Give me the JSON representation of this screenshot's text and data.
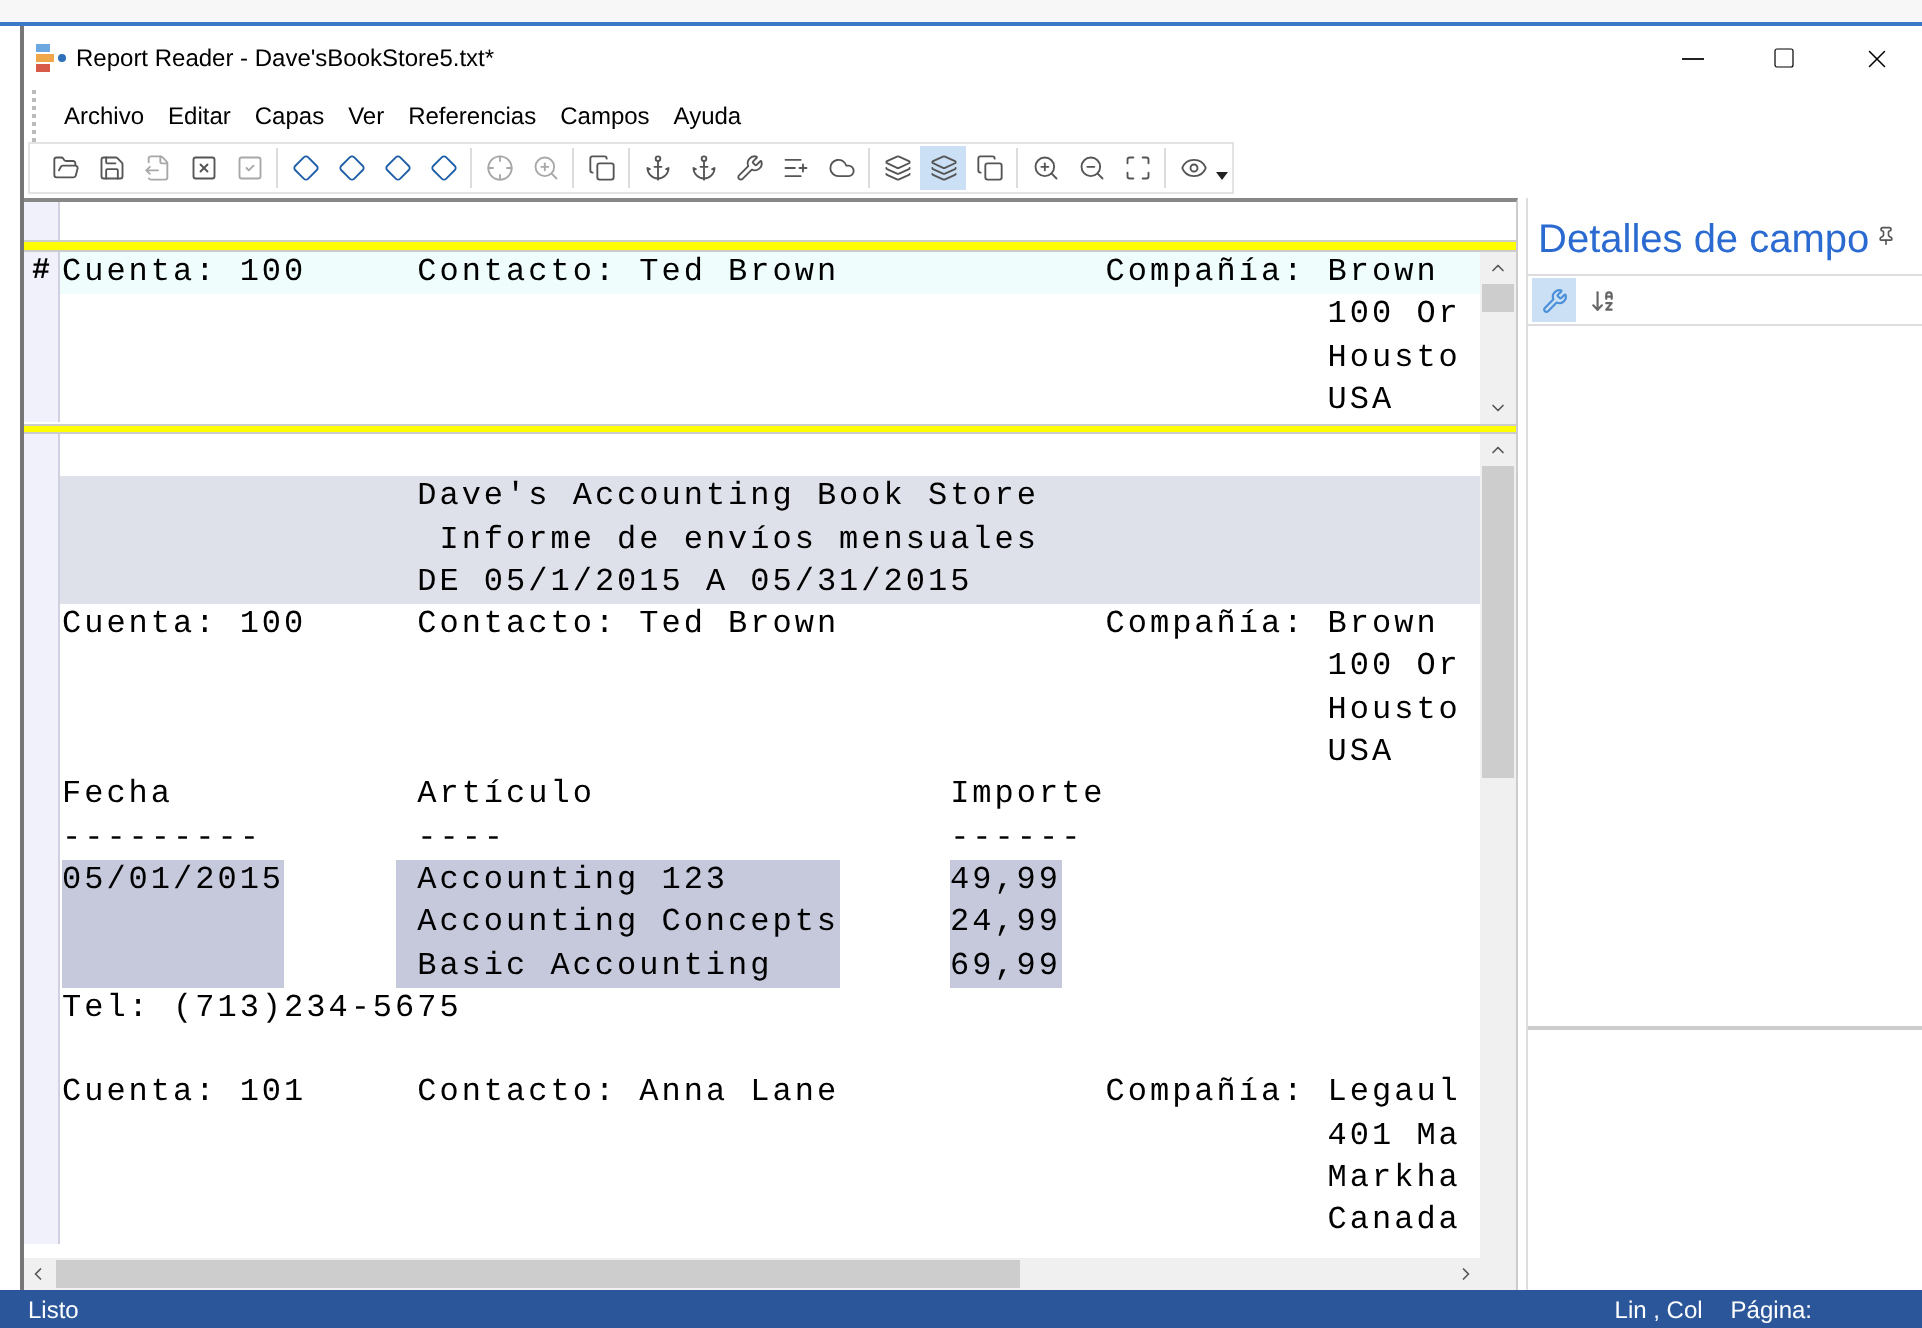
{
  "window": {
    "title": "Report Reader - Dave'sBookStore5.txt*"
  },
  "menu": [
    "Archivo",
    "Editar",
    "Capas",
    "Ver",
    "Referencias",
    "Campos",
    "Ayuda"
  ],
  "toolbar": [
    {
      "selected": false,
      "disabled": false
    },
    {
      "selected": false,
      "disabled": false
    },
    {
      "selected": false,
      "disabled": true
    },
    {
      "selected": false,
      "disabled": false
    },
    {
      "selected": false,
      "disabled": true
    },
    {
      "selected": false,
      "disabled": false
    },
    {
      "selected": false,
      "disabled": false
    },
    {
      "selected": false,
      "disabled": false
    },
    {
      "selected": false,
      "disabled": false
    },
    {
      "selected": false,
      "disabled": true
    },
    {
      "selected": false,
      "disabled": true
    },
    {
      "selected": false,
      "disabled": false
    },
    {
      "selected": false,
      "disabled": false
    },
    {
      "selected": false,
      "disabled": false
    },
    {
      "selected": false,
      "disabled": false
    },
    {
      "selected": false,
      "disabled": false
    },
    {
      "selected": false,
      "disabled": false
    },
    {
      "selected": false,
      "disabled": false
    },
    {
      "selected": true,
      "disabled": false
    },
    {
      "selected": false,
      "disabled": false
    },
    {
      "selected": false,
      "disabled": false
    },
    {
      "selected": false,
      "disabled": false
    },
    {
      "selected": false,
      "disabled": false
    },
    {
      "selected": false,
      "disabled": false
    }
  ],
  "top_pane": {
    "marker": "#",
    "lines": [
      {
        "kind": "text",
        "current": true,
        "band": false,
        "text": "Cuenta: 100     Contacto: Ted Brown            Compañía: Brown"
      },
      {
        "kind": "text",
        "current": false,
        "band": false,
        "text": "                                                         100 Or"
      },
      {
        "kind": "text",
        "current": false,
        "band": false,
        "text": "                                                         Housto"
      },
      {
        "kind": "text",
        "current": false,
        "band": false,
        "text": "                                                         USA"
      }
    ]
  },
  "bottom_pane": {
    "lines": [
      {
        "kind": "blank"
      },
      {
        "kind": "text",
        "current": false,
        "band": true,
        "text": "                Dave's Accounting Book Store"
      },
      {
        "kind": "text",
        "current": false,
        "band": true,
        "text": "                 Informe de envíos mensuales"
      },
      {
        "kind": "text",
        "current": false,
        "band": true,
        "text": "                DE 05/1/2015 A 05/31/2015"
      },
      {
        "kind": "text",
        "current": false,
        "band": false,
        "text": "Cuenta: 100     Contacto: Ted Brown            Compañía: Brown"
      },
      {
        "kind": "text",
        "current": false,
        "band": false,
        "text": "                                                         100 Or"
      },
      {
        "kind": "text",
        "current": false,
        "band": false,
        "text": "                                                         Housto"
      },
      {
        "kind": "text",
        "current": false,
        "band": false,
        "text": "                                                         USA"
      },
      {
        "kind": "text",
        "current": false,
        "band": false,
        "text": "Fecha           Artículo                Importe"
      },
      {
        "kind": "text",
        "current": false,
        "band": false,
        "text": "---------       ----                    ------"
      },
      {
        "kind": "item",
        "highlighted": true,
        "date": "05/01/2015",
        "article": "Accounting 123",
        "amount": "49,99"
      },
      {
        "kind": "item",
        "highlighted": true,
        "article": "Accounting Concepts",
        "amount": "24,99"
      },
      {
        "kind": "item",
        "highlighted": true,
        "article": "Basic Accounting",
        "amount": "69,99"
      },
      {
        "kind": "text",
        "current": false,
        "band": false,
        "text": "Tel: (713)234-5675"
      },
      {
        "kind": "blank"
      },
      {
        "kind": "text",
        "current": false,
        "band": false,
        "text": "Cuenta: 101     Contacto: Anna Lane            Compañía: Legaul"
      },
      {
        "kind": "text",
        "current": false,
        "band": false,
        "text": "                                                         401 Ma"
      },
      {
        "kind": "text",
        "current": false,
        "band": false,
        "text": "                                                         Markha"
      },
      {
        "kind": "text",
        "current": false,
        "band": false,
        "text": "                                                         Canada"
      }
    ]
  },
  "details_panel": {
    "title": "Detalles de campo",
    "tools": [
      {
        "selected": true
      },
      {
        "selected": false
      }
    ]
  },
  "status_bar": {
    "message": "Listo",
    "position": "Lin , Col",
    "page": "Página:"
  }
}
